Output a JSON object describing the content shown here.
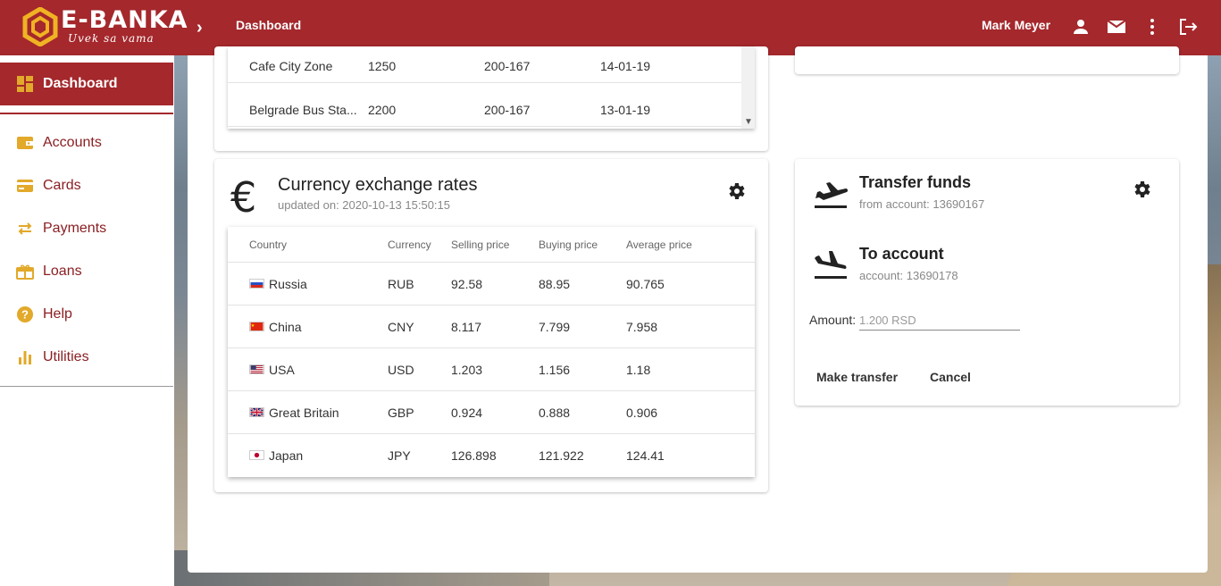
{
  "header": {
    "brand": "E-BANKA",
    "tagline": "Uvek sa vama",
    "breadcrumb": "Dashboard",
    "user_name": "Mark Meyer",
    "icons": [
      "person-icon",
      "mail-icon",
      "more-vert-icon",
      "logout-icon"
    ]
  },
  "sidebar": {
    "active": "Dashboard",
    "items": [
      {
        "label": "Accounts",
        "icon": "wallet-icon"
      },
      {
        "label": "Cards",
        "icon": "credit-card-icon"
      },
      {
        "label": "Payments",
        "icon": "swap-icon"
      },
      {
        "label": "Loans",
        "icon": "gift-icon"
      },
      {
        "label": "Help",
        "icon": "help-icon"
      },
      {
        "label": "Utilities",
        "icon": "bar-chart-icon"
      }
    ]
  },
  "transactions": {
    "rows": [
      {
        "name": "Cafe City Zone",
        "amount": "1250",
        "account": "200-167",
        "date": "14-01-19"
      },
      {
        "name": "Belgrade Bus Sta...",
        "amount": "2200",
        "account": "200-167",
        "date": "13-01-19"
      }
    ]
  },
  "currency": {
    "title": "Currency exchange rates",
    "updated": "updated on: 2020-10-13 15:50:15",
    "columns": [
      "Country",
      "Currency",
      "Selling price",
      "Buying price",
      "Average price"
    ],
    "rows": [
      {
        "country": "Russia",
        "currency": "RUB",
        "selling": "92.58",
        "buying": "88.95",
        "average": "90.765"
      },
      {
        "country": "China",
        "currency": "CNY",
        "selling": "8.117",
        "buying": "7.799",
        "average": "7.958"
      },
      {
        "country": "USA",
        "currency": "USD",
        "selling": "1.203",
        "buying": "1.156",
        "average": "1.18"
      },
      {
        "country": "Great Britain",
        "currency": "GBP",
        "selling": "0.924",
        "buying": "0.888",
        "average": "0.906"
      },
      {
        "country": "Japan",
        "currency": "JPY",
        "selling": "126.898",
        "buying": "121.922",
        "average": "124.41"
      }
    ]
  },
  "transfer": {
    "title": "Transfer funds",
    "from": "from account: 13690167",
    "to_title": "To account",
    "to": "account: 13690178",
    "amount_label": "Amount:",
    "amount_value": "1.200 RSD",
    "make_transfer": "Make transfer",
    "cancel": "Cancel"
  },
  "colors": {
    "brand": "#a4282c",
    "accent": "#e2a92a"
  }
}
